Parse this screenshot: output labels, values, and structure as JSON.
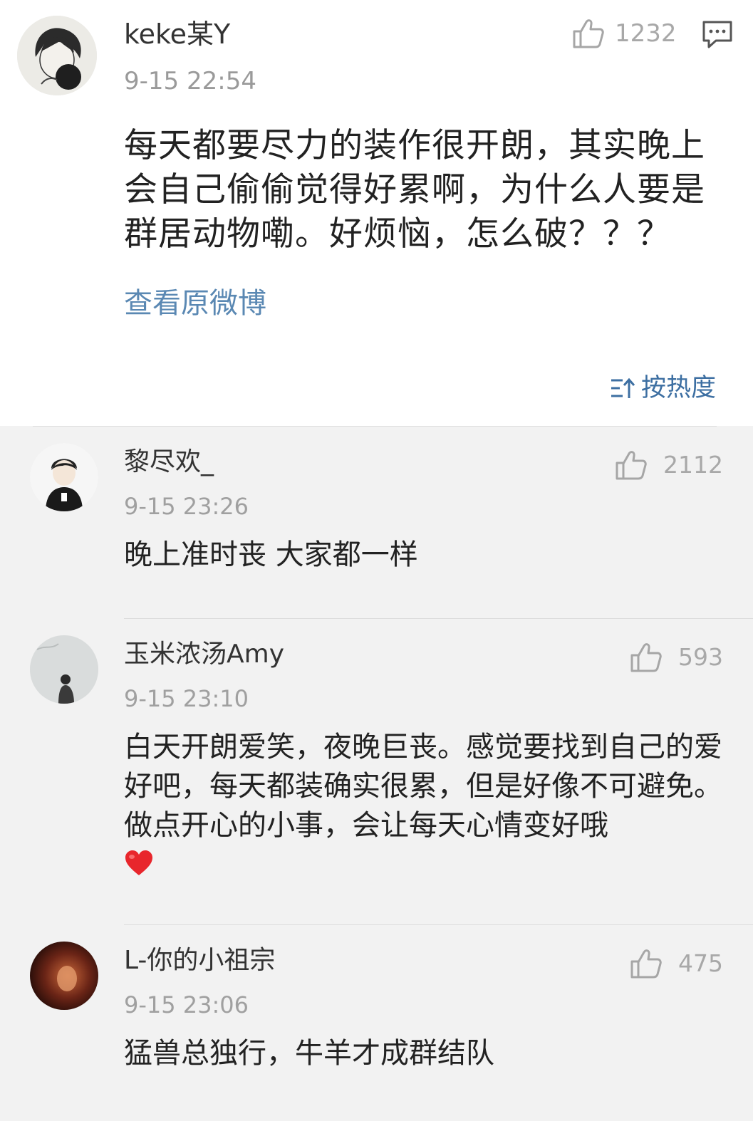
{
  "post": {
    "username": "keke某Y",
    "timestamp": "9-15 22:54",
    "like_count": "1232",
    "like_icon": "thumbs-up-icon",
    "comment_icon": "comment-icon",
    "text": "每天都要尽力的装作很开朗，其实晚上会自己偷偷觉得好累啊，为什么人要是群居动物嘞。好烦恼，怎么破？？？",
    "view_original": "查看原微博",
    "sort_label": "按热度",
    "sort_icon": "sort-icon"
  },
  "comments": [
    {
      "username": "黎尽欢_",
      "timestamp": "9-15 23:26",
      "like_count": "2112",
      "text": "晚上准时丧 大家都一样",
      "has_heart": false
    },
    {
      "username": "玉米浓汤Amy",
      "timestamp": "9-15 23:10",
      "like_count": "593",
      "text": "白天开朗爱笑，夜晚巨丧。感觉要找到自己的爱好吧，每天都装确实很累，但是好像不可避免。做点开心的小事，会让每天心情变好哦",
      "has_heart": true,
      "heart_icon": "heart-emoji-icon"
    },
    {
      "username": "L-你的小祖宗",
      "timestamp": "9-15 23:06",
      "like_count": "475",
      "text": "猛兽总独行，牛羊才成群结队",
      "has_heart": false
    }
  ],
  "colors": {
    "link": "#5a88b3",
    "sort": "#3d6fa2",
    "background": "#f2f2f2",
    "heart": "#e8262c"
  }
}
